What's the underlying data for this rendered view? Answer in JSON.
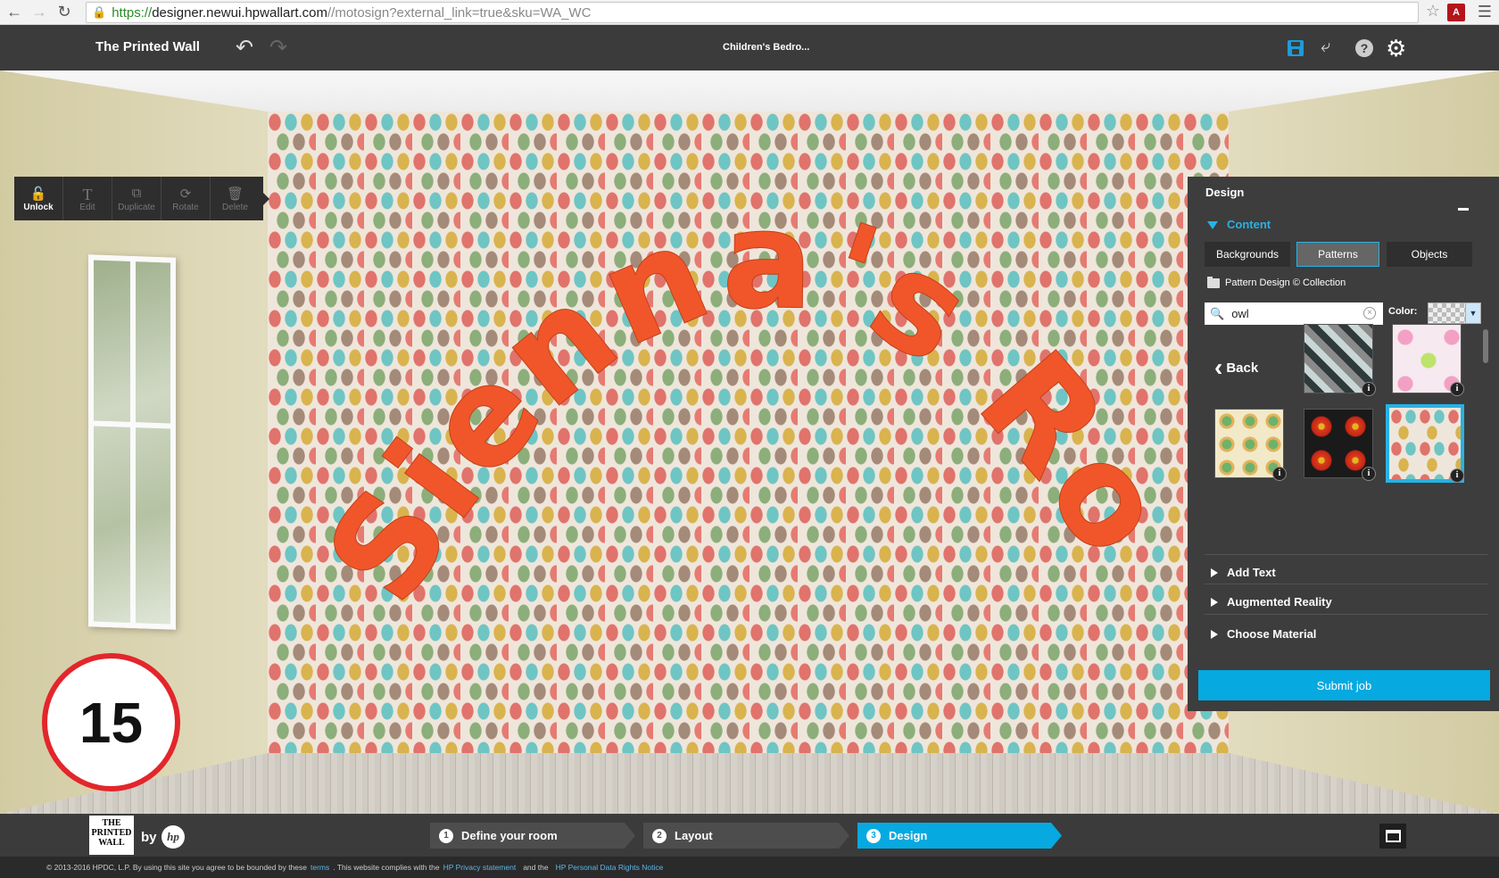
{
  "browser": {
    "url_scheme": "https://",
    "url_host": "designer.newui.hpwallart.com",
    "url_path": "//motosign?external_link=true&sku=WA_WC"
  },
  "app": {
    "title": "The Printed Wall",
    "document_name": "Children's Bedro..."
  },
  "edit_toolbar": {
    "tools": [
      {
        "label": "Unlock",
        "icon": "unlock-icon",
        "active": true
      },
      {
        "label": "Edit",
        "icon": "text-icon",
        "active": false
      },
      {
        "label": "Duplicate",
        "icon": "duplicate-icon",
        "active": false
      },
      {
        "label": "Rotate",
        "icon": "rotate-icon",
        "active": false
      },
      {
        "label": "Delete",
        "icon": "trash-icon",
        "active": false
      }
    ]
  },
  "wall": {
    "text": "Sienna's Room",
    "text_color": "#f0562a",
    "pattern": "owl"
  },
  "badge": {
    "number": "15",
    "border_color": "#e3262b"
  },
  "panel": {
    "title": "Design",
    "section": "Content",
    "tabs": [
      {
        "label": "Backgrounds",
        "active": false
      },
      {
        "label": "Patterns",
        "active": true
      },
      {
        "label": "Objects",
        "active": false
      }
    ],
    "collection": "Pattern Design © Collection",
    "search": {
      "value": "owl"
    },
    "color_label": "Color:",
    "back_label": "Back",
    "thumbnails": [
      {
        "name": "geometric-triangles",
        "selected": false
      },
      {
        "name": "pink-owls",
        "selected": false
      },
      {
        "name": "circle-flowers",
        "selected": false
      },
      {
        "name": "red-dots",
        "selected": false
      },
      {
        "name": "colorful-owls",
        "selected": true
      }
    ],
    "collapsed_sections": [
      "Add Text",
      "Augmented Reality",
      "Choose Material"
    ],
    "submit_label": "Submit job",
    "accent_color": "#06a9e0"
  },
  "steps": [
    {
      "number": "1",
      "label": "Define your room",
      "active": false
    },
    {
      "number": "2",
      "label": "Layout",
      "active": false
    },
    {
      "number": "3",
      "label": "Design",
      "active": true
    }
  ],
  "brand": {
    "logo_text": "THE PRINTED WALL",
    "by": "by",
    "hp": "hp"
  },
  "footer": {
    "prefix": "© 2013-2016 HPDC, L.P.  By using this site you agree to be bounded by these",
    "terms_link": "terms",
    "middle": ". This website complies with the",
    "privacy_link": "HP Privacy statement",
    "and": "and the",
    "rights_link": "HP Personal Data Rights Notice"
  }
}
